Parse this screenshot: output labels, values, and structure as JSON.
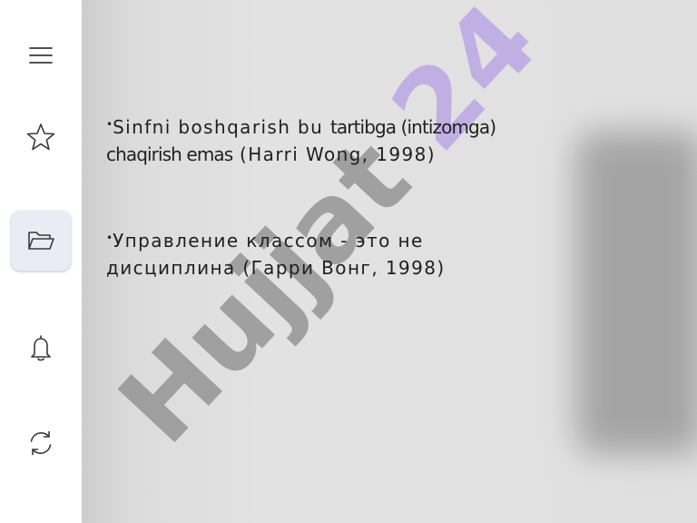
{
  "sidebar": {
    "items": [
      {
        "icon": "menu-icon"
      },
      {
        "icon": "star-icon"
      },
      {
        "icon": "folder-open-icon",
        "active": true
      },
      {
        "icon": "bell-icon"
      },
      {
        "icon": "refresh-icon"
      }
    ]
  },
  "slide": {
    "watermark": "Hujjat 24",
    "bullets": [
      {
        "marker": "•",
        "line1_a": "Sinfni boshqarish bu ",
        "line1_b": "tartibga (intizomga)",
        "line2_a": "chaqirish emas",
        "line2_b": " (Harri Wong, 1998)"
      },
      {
        "marker": "•",
        "line1": "Управление классом - это не",
        "line2": "дисциплина (Гарри Вонг, 1998)"
      }
    ]
  },
  "colors": {
    "watermark_dark": "#8a8a8a",
    "watermark_purple": "#b49ae6",
    "slide_bg": "#e0e0e0",
    "active_item_bg": "#e9ecf5"
  }
}
